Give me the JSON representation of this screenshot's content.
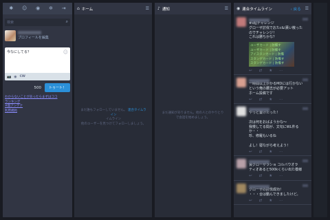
{
  "drawer": {
    "header_icons": [
      "asterisk-icon",
      "people-icon",
      "globe-icon",
      "logout-icon"
    ],
    "search": {
      "placeholder": "検索"
    },
    "account": {
      "edit_label": "プロフィールを編集"
    },
    "compose": {
      "placeholder": "今なにしてる？",
      "cw_label": "CW",
      "counter": "500",
      "toot_label": "トゥート！"
    },
    "links": [
      "わからないことがあったらまずはココ",
      "ランキング",
      "#無アンテナ",
      "利用規約"
    ]
  },
  "columns": {
    "home": {
      "title": "ホーム",
      "empty_lines": [
        "まだ誰もフォローしていません。",
        "イムライン",
        "他のユーザーを見つけてフォローしましょう。"
      ],
      "empty_link": "連合タイムライン"
    },
    "notifications": {
      "title": "通知",
      "empty_lines": [
        "まだ通知がありません。他の人とのやりとり",
        "で会話を始めましょう。"
      ]
    },
    "federated": {
      "title": "連合タイムライン",
      "back_label": "戻る",
      "statuses": [
        {
          "avatar_color": "#c27a7a",
          "body": "#s帖チャレンジ\nグローザ討伐でおたc&l貰い散った\nのでチャレンジ！\nこれは勝ちかな？",
          "has_media": true,
          "media_lines": [
            "ユーザカード | 防備す",
            "ユーザカード | 防備す",
            "アイスタンカード | 防備",
            "スタンゲカード | 防備す",
            "スタンゲカード | 防備す"
          ]
        },
        {
          "avatar_color": "#d8a090",
          "body": "一時間以上かかるMDには行かない\nという俺の腰志が必要アット\nホーム投稿です",
          "has_media": false
        },
        {
          "avatar_color": "#e0e0e0",
          "body": "やっと置けたった！\n\n次は何をおばようかな～\n我慢してる間が、文句にWL件る\nか・・\n珍、修羅もいるね\n\nよし！寝ながら考えよう！",
          "has_media": false
        },
        {
          "avatar_color": "#b8a0a8",
          "body": "良グローザラショ コルバウオラ\nティオあると500kくらい出た模様",
          "has_media": false
        },
        {
          "avatar_color": "#a08860",
          "body": "グローザの討伐成功！\n・・・合は動んできましたけど。",
          "has_media": false
        }
      ]
    }
  },
  "icons": {
    "home": "home-icon",
    "bell": "bell-icon",
    "globe": "globe-icon",
    "settings": "sliders-icon"
  }
}
